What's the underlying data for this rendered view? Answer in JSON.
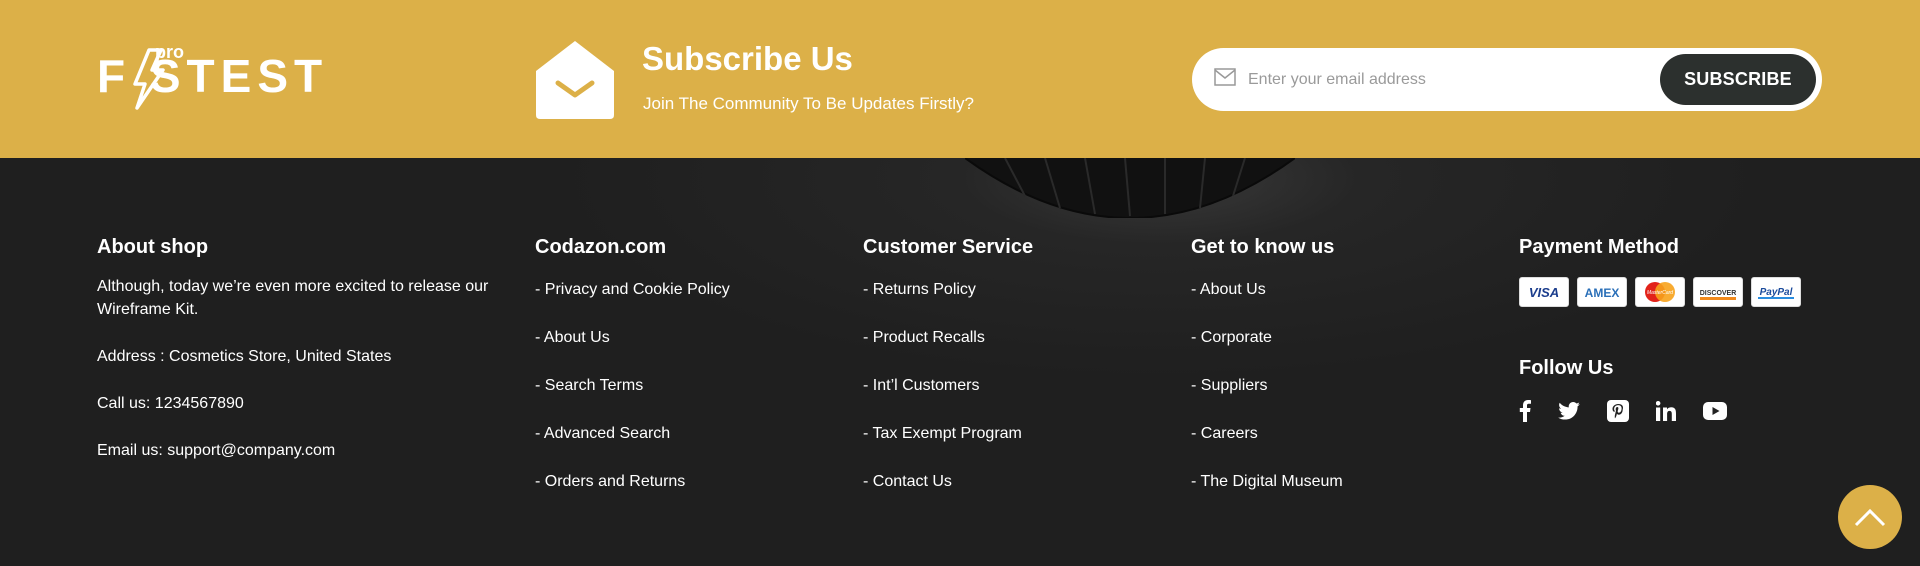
{
  "brand": {
    "logo_text": "FASTEST",
    "logo_badge": "pro"
  },
  "subscribe": {
    "title": "Subscribe Us",
    "subtitle": "Join The Community To Be Updates Firstly?",
    "placeholder": "Enter your email address",
    "button_label": "SUBSCRIBE"
  },
  "about": {
    "heading": "About shop",
    "text": "Although, today we’re even more excited to release our Wireframe Kit.",
    "address": "Address : Cosmetics Store, United States",
    "call": "Call us: 1234567890",
    "email": "Email us: support@company.com"
  },
  "codazon": {
    "heading": "Codazon.com",
    "links": [
      "Privacy and Cookie Policy",
      "About Us",
      "Search Terms",
      "Advanced Search",
      "Orders and Returns"
    ]
  },
  "customer_service": {
    "heading": "Customer Service",
    "links": [
      "Returns Policy",
      "Product Recalls",
      "Int’l Customers",
      "Tax Exempt Program",
      "Contact Us"
    ]
  },
  "get_to_know": {
    "heading": "Get to know us",
    "links": [
      "About Us",
      "Corporate",
      "Suppliers",
      "Careers",
      "The Digital Museum"
    ]
  },
  "payment": {
    "heading": "Payment Method",
    "cards": [
      "VISA",
      "AMEX",
      "MasterCard",
      "DISCOVER",
      "PayPal"
    ]
  },
  "follow": {
    "heading": "Follow Us",
    "icons": [
      "facebook-icon",
      "twitter-icon",
      "pinterest-icon",
      "linkedin-icon",
      "youtube-icon"
    ]
  },
  "colors": {
    "accent": "#dcb048",
    "dark_button": "#2c302e",
    "footer_bg": "#222222"
  }
}
